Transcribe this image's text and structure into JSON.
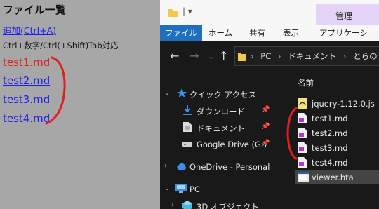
{
  "viewer": {
    "title": "ファイル一覧",
    "add_link": "追加(Ctrl+A)",
    "hint": "Ctrl+数字/Ctrl(+Shift)Tab対応",
    "files": [
      "test1.md",
      "test2.md",
      "test3.md",
      "test4.md"
    ],
    "active_index": 0
  },
  "explorer": {
    "quick_access_glyph": "|  ▾",
    "manage_tab": "管理",
    "ribbon_tabs": [
      "ファイル",
      "ホーム",
      "共有",
      "表示",
      "アプリケーション ツ"
    ],
    "breadcrumbs": [
      "PC",
      "ドキュメント",
      "とらのまき"
    ],
    "nav_pane": [
      {
        "label": "クイック アクセス",
        "icon": "star-icon"
      },
      {
        "label": "ダウンロード",
        "icon": "download-icon",
        "pinned": true
      },
      {
        "label": "ドキュメント",
        "icon": "document-icon",
        "pinned": true
      },
      {
        "label": "Google Drive (G:)",
        "icon": "drive-icon",
        "pinned": true
      },
      {
        "label": "OneDrive - Personal",
        "icon": "cloud-icon"
      },
      {
        "label": "PC",
        "icon": "pc-icon"
      },
      {
        "label": "3D オブジェクト",
        "icon": "cube-icon"
      }
    ],
    "column_header": "名前",
    "files": [
      {
        "name": "jquery-1.12.0.js",
        "icon": "js-file-icon"
      },
      {
        "name": "test1.md",
        "icon": "md-file-icon"
      },
      {
        "name": "test2.md",
        "icon": "md-file-icon"
      },
      {
        "name": "test3.md",
        "icon": "md-file-icon"
      },
      {
        "name": "test4.md",
        "icon": "md-file-icon"
      },
      {
        "name": "viewer.hta",
        "icon": "hta-file-icon",
        "selected": true
      }
    ]
  },
  "colors": {
    "annotation_red": "#e01e1e",
    "link_blue": "#1d1df0",
    "accent_blue": "#1f6fbf",
    "manage_tab": "#e3d3f7"
  }
}
